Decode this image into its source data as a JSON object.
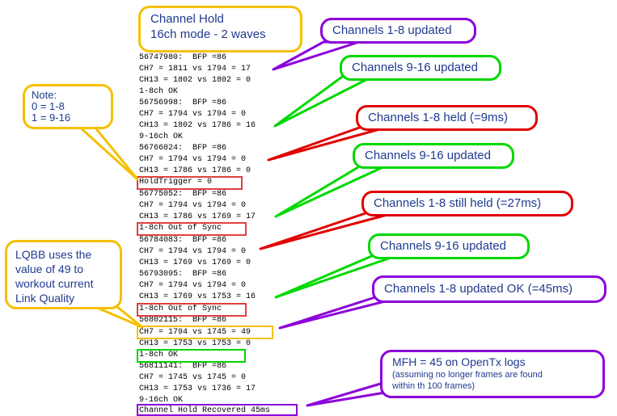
{
  "log_lines": [
    "56747980:  BFP =86",
    "CH7 = 1811 vs 1794 = 17",
    "CH13 = 1802 vs 1802 = 0",
    "1-8ch OK",
    "56756998:  BFP =86",
    "CH7 = 1794 vs 1794 = 0",
    "CH13 = 1802 vs 1786 = 16",
    "9-16ch OK",
    "56766024:  BFP =86",
    "CH7 = 1794 vs 1794 = 0",
    "CH13 = 1786 vs 1786 = 0",
    "HoldTrigger = 0",
    "56775052:  BFP =86",
    "CH7 = 1794 vs 1794 = 0",
    "CH13 = 1786 vs 1769 = 17",
    "1-8ch Out of Sync",
    "56784083:  BFP =86",
    "CH7 = 1794 vs 1794 = 0",
    "CH13 = 1769 vs 1769 = 0",
    "56793095:  BFP =86",
    "CH7 = 1794 vs 1794 = 0",
    "CH13 = 1769 vs 1753 = 16",
    "1-8ch Out of Sync",
    "56802115:  BFP =86",
    "CH7 = 1794 vs 1745 = 49",
    "CH13 = 1753 vs 1753 = 0",
    "1-8ch OK",
    "56811141:  BFP =86",
    "CH7 = 1745 vs 1745 = 0",
    "CH13 = 1753 vs 1736 = 17",
    "9-16ch OK",
    "Channel Hold Recovered 45ms"
  ],
  "callouts": {
    "title_line1": "Channel Hold",
    "title_line2": "16ch mode - 2 waves",
    "note_line1": "Note:",
    "note_line2": "0 = 1-8",
    "note_line3": "1 = 9-16",
    "lqbb_line1": "LQBB uses the",
    "lqbb_line2": "value of 49 to",
    "lqbb_line3": "workout current",
    "lqbb_line4": "Link Quality",
    "c1": "Channels 1-8 updated",
    "c2": "Channels 9-16 updated",
    "c3": "Channels 1-8 held (=9ms)",
    "c4": "Channels 9-16 updated",
    "c5": "Channels 1-8 still held (=27ms)",
    "c6": "Channels 9-16 updated",
    "c7": "Channels 1-8 updated OK (=45ms)",
    "mfh_main": "MFH = 45 on OpenTx logs",
    "mfh_sub1": "(assuming no longer frames are found",
    "mfh_sub2": "within th 100 frames)"
  },
  "colors": {
    "yellow": "#f5c000",
    "purple": "#8b00d9",
    "green": "#00d800",
    "red": "#e00000",
    "orange": "#ff8a2a",
    "log_red": "#e04040",
    "text": "#1f3a8f"
  }
}
